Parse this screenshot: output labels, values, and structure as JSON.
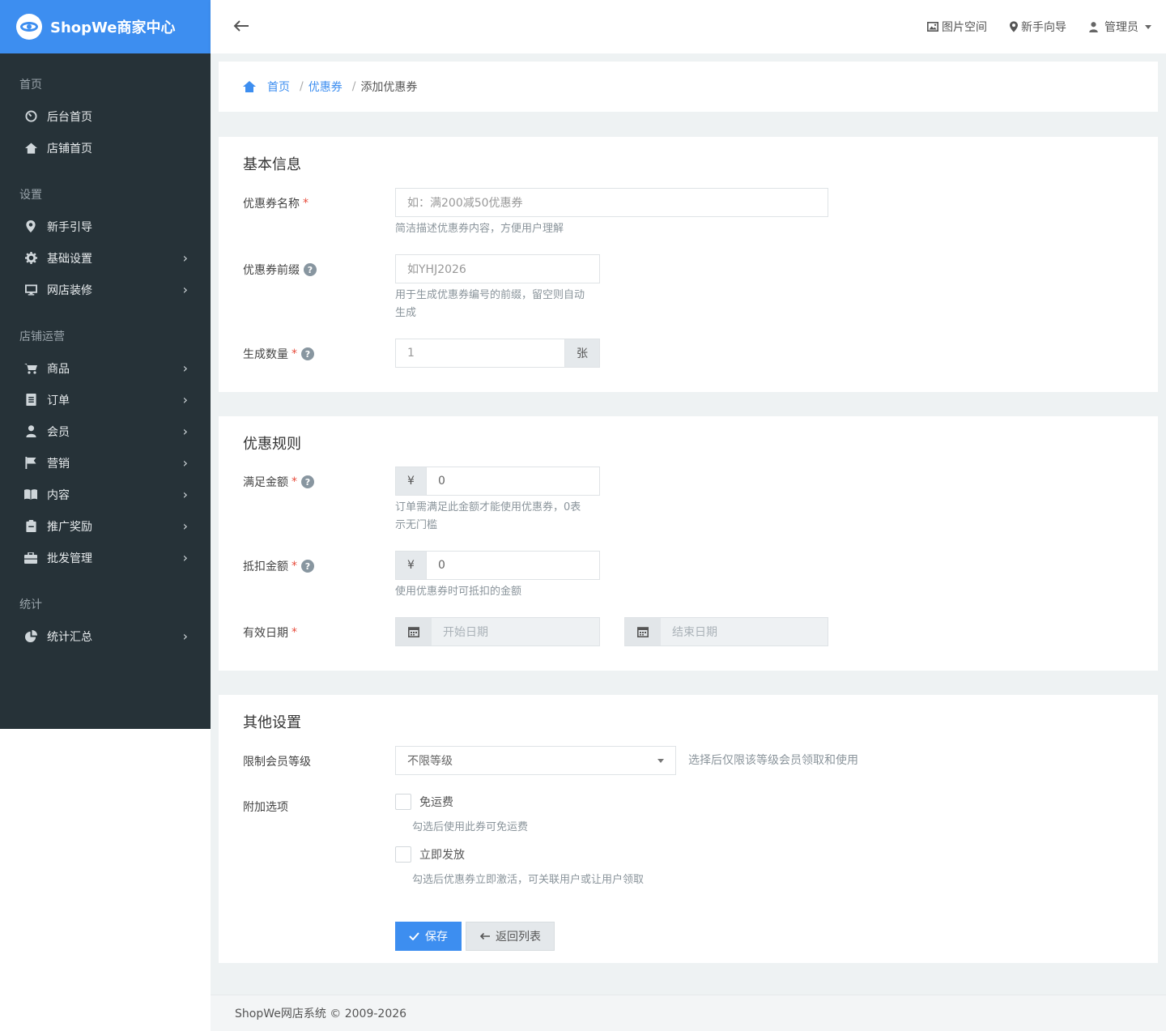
{
  "brand": {
    "name": "ShopWe商家中心"
  },
  "header": {
    "links": [
      {
        "label": "图片空间",
        "icon": "image-icon"
      },
      {
        "label": "新手向导",
        "icon": "map-marker-icon"
      },
      {
        "label": "管理员",
        "icon": "user-icon"
      }
    ]
  },
  "sidebar": {
    "sections": [
      {
        "title": "首页",
        "items": [
          {
            "label": "后台首页",
            "icon": "dashboard-icon"
          },
          {
            "label": "店铺首页",
            "icon": "home-icon"
          }
        ]
      },
      {
        "title": "设置",
        "items": [
          {
            "label": "新手引导",
            "icon": "map-marker-icon"
          },
          {
            "label": "基础设置",
            "icon": "gear-icon"
          },
          {
            "label": "网店装修",
            "icon": "monitor-icon"
          }
        ]
      },
      {
        "title": "店铺运营",
        "items": [
          {
            "label": "商品",
            "icon": "cart-icon"
          },
          {
            "label": "订单",
            "icon": "document-icon"
          },
          {
            "label": "会员",
            "icon": "user-icon"
          },
          {
            "label": "营销",
            "icon": "flag-icon"
          },
          {
            "label": "内容",
            "icon": "book-icon"
          },
          {
            "label": "推广奖励",
            "icon": "clipboard-icon"
          },
          {
            "label": "批发管理",
            "icon": "briefcase-icon"
          }
        ]
      },
      {
        "title": "统计",
        "items": [
          {
            "label": "统计汇总",
            "icon": "pie-chart-icon"
          }
        ]
      }
    ]
  },
  "breadcrumb": {
    "home": "首页",
    "parent": "优惠券",
    "current": "添加优惠券",
    "sep": "/"
  },
  "basic": {
    "title": "基本信息",
    "name_label": "优惠券名称",
    "name_placeholder": "如：满200减50优惠券",
    "name_help": "简洁描述优惠券内容，方便用户理解",
    "prefix_label": "优惠券前缀",
    "prefix_placeholder": "如YHJ2026",
    "prefix_help_1": "用于生成优惠券编号的前缀，留空则自动",
    "prefix_help_2": "生成",
    "count_label": "生成数量",
    "count_value": "1",
    "count_unit": "张"
  },
  "rules": {
    "title": "优惠规则",
    "min_label": "满足金额",
    "currency": "¥",
    "min_value": "0",
    "min_help_1": "订单需满足此金额才能使用优惠券，0表",
    "min_help_2": "示无门槛",
    "deduct_label": "抵扣金额",
    "deduct_value": "0",
    "deduct_help": "使用优惠券时可抵扣的金额",
    "date_label": "有效日期",
    "start_placeholder": "开始日期",
    "end_placeholder": "结束日期"
  },
  "other": {
    "title": "其他设置",
    "level_label": "限制会员等级",
    "level_value": "不限等级",
    "level_help": "选择后仅限该等级会员领取和使用",
    "extra_label": "附加选项",
    "opt1_label": "免运费",
    "opt1_help": "勾选后使用此券可免运费",
    "opt2_label": "立即发放",
    "opt2_help": "勾选后优惠券立即激活，可关联用户或让用户领取",
    "save": "保存",
    "back": "返回列表"
  },
  "footer": {
    "text": "ShopWe网店系统 © 2009-2026"
  },
  "colors": {
    "primary": "#3d8ef0",
    "sidebar": "#263238",
    "required": "#e74c3c"
  }
}
